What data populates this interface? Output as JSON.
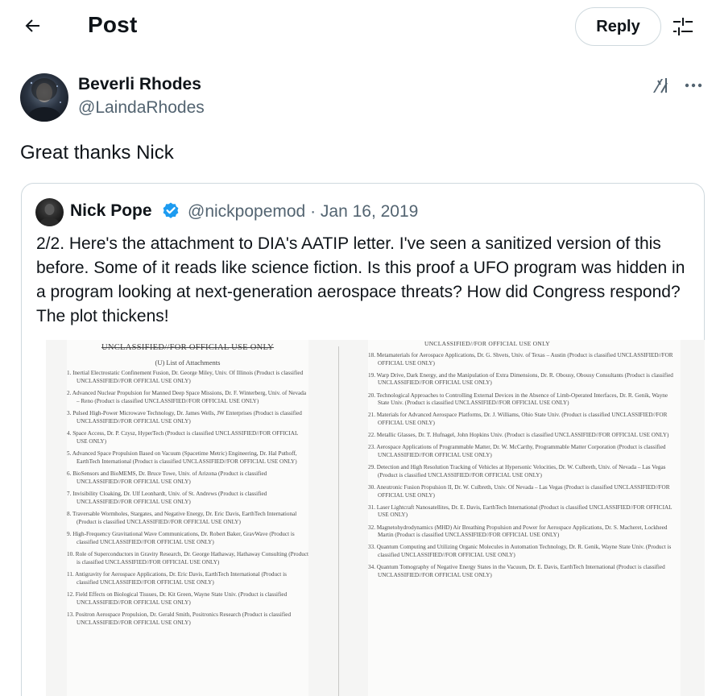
{
  "header": {
    "title": "Post",
    "reply_label": "Reply"
  },
  "post": {
    "author_name": "Beverli Rhodes",
    "author_handle": "@LaindaRhodes",
    "text": "Great thanks Nick"
  },
  "quote": {
    "author_name": "Nick Pope",
    "author_handle": "@nickpopemod",
    "date": "Jan 16, 2019",
    "meta": "@nickpopemod · Jan 16, 2019",
    "verified": true,
    "text": "2/2. Here's the attachment to DIA's AATIP letter. I've seen a sanitized version of this before. Some of it reads like science fiction. Is this proof a UFO program was hidden in a program looking at next-generation aerospace threats? How did Congress respond? The plot thickens!"
  },
  "document": {
    "left_header": "UNCLASSIFIED//FOR OFFICIAL USE ONLY",
    "left_subheader": "(U) List of Attachments",
    "right_header": "UNCLASSIFIED//FOR OFFICIAL USE ONLY",
    "left_items": [
      "1. Inertial Electrostatic Confinement Fusion, Dr. George Miley, Univ. Of Illinois (Product is classified UNCLASSIFIED//FOR OFFICIAL USE ONLY)",
      "2. Advanced Nuclear Propulsion for Manned Deep Space Missions, Dr. F. Winterberg, Univ. of Nevada – Reno (Product is classified UNCLASSIFIED//FOR OFFICIAL USE ONLY)",
      "3. Pulsed High-Power Microwave Technology, Dr. James Wells, JW Enterprises (Product is classified UNCLASSIFIED//FOR OFFICIAL USE ONLY)",
      "4. Space Access, Dr. P. Czysz, HyperTech (Product is classified UNCLASSIFIED//FOR OFFICIAL USE ONLY)",
      "5. Advanced Space Propulsion Based on Vacuum (Spacetime Metric) Engineering, Dr. Hal Puthoff, EarthTech International (Product is classified UNCLASSIFIED//FOR OFFICIAL USE ONLY)",
      "6. BioSensors and BioMEMS, Dr. Bruce Towe, Univ. of Arizona (Product is classified UNCLASSIFIED//FOR OFFICIAL USE ONLY)",
      "7. Invisibility Cloaking, Dr. Ulf Leonhardt, Univ. of St. Andrews (Product is classified UNCLASSIFIED//FOR OFFICIAL USE ONLY)",
      "8. Traversable Wormholes, Stargates, and Negative Energy, Dr. Eric Davis, EarthTech International (Product is classified UNCLASSIFIED//FOR OFFICIAL USE ONLY)",
      "9. High-Frequency Gravitational Wave Communications, Dr. Robert Baker, GravWave (Product is classified UNCLASSIFIED//FOR OFFICIAL USE ONLY)",
      "10. Role of Superconductors in Gravity Research, Dr. George Hathaway, Hathaway Consulting (Product is classified UNCLASSIFIED//FOR OFFICIAL USE ONLY)",
      "11. Antigravity for Aerospace Applications, Dr. Eric Davis, EarthTech International (Product is classified UNCLASSIFIED//FOR OFFICIAL USE ONLY)",
      "12. Field Effects on Biological Tissues, Dr. Kit Green, Wayne State Univ. (Product is classified UNCLASSIFIED//FOR OFFICIAL USE ONLY)",
      "13. Positron Aerospace Propulsion, Dr. Gerald Smith, Positronics Research (Product is classified UNCLASSIFIED//FOR OFFICIAL USE ONLY)"
    ],
    "right_items": [
      "18. Metamaterials for Aerospace Applications, Dr. G. Shvets, Univ. of Texas – Austin (Product is classified UNCLASSIFIED//FOR OFFICIAL USE ONLY)",
      "19. Warp Drive, Dark Energy, and the Manipulation of Extra Dimensions, Dr. R. Obousy, Obousy Consultants (Product is classified UNCLASSIFIED//FOR OFFICIAL USE ONLY)",
      "20. Technological Approaches to Controlling External Devices in the Absence of Limb-Operated Interfaces, Dr. R. Genik, Wayne State Univ. (Product is classified UNCLASSIFIED//FOR OFFICIAL USE ONLY)",
      "21. Materials for Advanced Aerospace Platforms, Dr. J. Williams, Ohio State Univ. (Product is classified UNCLASSIFIED//FOR OFFICIAL USE ONLY)",
      "22. Metallic Glasses, Dr. T. Hufnagel, John Hopkins Univ. (Product is classified UNCLASSIFIED//FOR OFFICIAL USE ONLY)",
      "23. Aerospace Applications of Programmable Matter, Dr. W. McCarthy, Programmable Matter Corporation (Product is classified UNCLASSIFIED//FOR OFFICIAL USE ONLY)",
      "29. Detection and High Resolution Tracking of Vehicles at Hypersonic Velocities, Dr. W. Culbreth, Univ. of Nevada – Las Vegas (Product is classified UNCLASSIFIED//FOR OFFICIAL USE ONLY)",
      "30. Aneutronic Fusion Propulsion II, Dr. W. Culbreth, Univ. Of Nevada – Las Vegas (Product is classified UNCLASSIFIED//FOR OFFICIAL USE ONLY)",
      "31. Laser Lightcraft Nanosatellites, Dr. E. Davis, EarthTech International (Product is classified UNCLASSIFIED//FOR OFFICIAL USE ONLY)",
      "32. Magnetohydrodynamics (MHD) Air Breathing Propulsion and Power for Aerospace Applications, Dr. S. Macheret, Lockheed Martin (Product is classified UNCLASSIFIED//FOR OFFICIAL USE ONLY)",
      "33. Quantum Computing and Utilizing Organic Molecules in Automation Technology, Dr. R. Genik, Wayne State Univ. (Product is classified UNCLASSIFIED//FOR OFFICIAL USE ONLY)",
      "34. Quantum Tomography of Negative Energy States in the Vacuum, Dr. E. Davis, EarthTech International (Product is classified UNCLASSIFIED//FOR OFFICIAL USE ONLY)"
    ]
  },
  "colors": {
    "text_primary": "#0f1419",
    "text_secondary": "#536471",
    "border": "#cfd9de",
    "verified_blue": "#1d9bf0"
  }
}
